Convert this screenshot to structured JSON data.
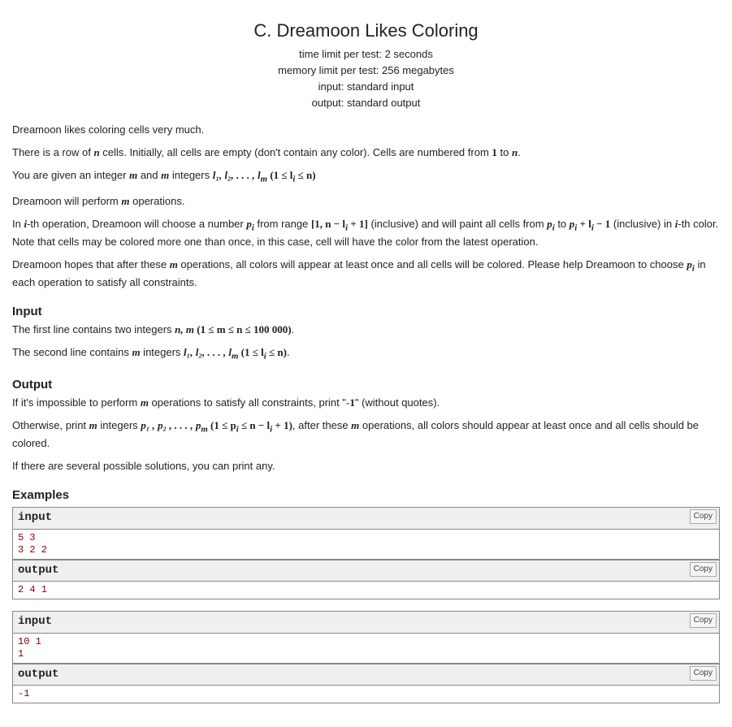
{
  "title": "C. Dreamoon Likes Coloring",
  "limits": {
    "time": "time limit per test: 2 seconds",
    "memory": "memory limit per test: 256 megabytes",
    "input": "input: standard input",
    "output": "output: standard output"
  },
  "statement": {
    "p1": "Dreamoon likes coloring cells very much.",
    "p2a": "There is a row of ",
    "p2b": " cells. Initially, all cells are empty (don't contain any color). Cells are numbered from ",
    "p2c": " to ",
    "p2d": ".",
    "p3a": "You are given an integer ",
    "p3b": " and ",
    "p3c": " integers ",
    "p4a": "Dreamoon will perform ",
    "p4b": " operations.",
    "p5a": "In ",
    "p5b": "-th operation, Dreamoon will choose a number ",
    "p5c": " from range ",
    "p5d": " (inclusive) and will paint all cells from ",
    "p5e": " to ",
    "p5f": " (inclusive) in ",
    "p5g": "-th color. Note that cells may be colored more one than once, in this case, cell will have the color from the latest operation.",
    "p6a": "Dreamoon hopes that after these ",
    "p6b": " operations, all colors will appear at least once and all cells will be colored. Please help Dreamoon to choose ",
    "p6c": " in each operation to satisfy all constraints."
  },
  "input_section": {
    "title": "Input",
    "p1a": "The first line contains two integers ",
    "p1b": ".",
    "p2a": "The second line contains ",
    "p2b": " integers ",
    "p2c": "."
  },
  "output_section": {
    "title": "Output",
    "p1a": "If it's impossible to perform ",
    "p1b": " operations to satisfy all constraints, print \"",
    "p1c": "\" (without quotes).",
    "p2a": "Otherwise, print ",
    "p2b": " integers ",
    "p2c": ", after these ",
    "p2d": " operations, all colors should appear at least once and all cells should be colored.",
    "p3": "If there are several possible solutions, you can print any."
  },
  "examples_title": "Examples",
  "labels": {
    "input": "input",
    "output": "output",
    "copy": "Copy"
  },
  "examples": [
    {
      "input": "5 3\n3 2 2",
      "output": "2 4 1"
    },
    {
      "input": "10 1\n1",
      "output": "-1"
    }
  ],
  "math": {
    "n": "n",
    "m": "m",
    "one": "1",
    "neg1": "-1",
    "i": "i",
    "pi": "p",
    "pi_sub": "i",
    "l_list": "l₁, l₂, . . . , l",
    "l_sub_m": "m",
    "l_constraint_open": " (1 ≤ l",
    "l_constraint_close": " ≤ n)",
    "nm": "n, m",
    "nm_constraint": " (1 ≤ m ≤ n ≤ 100 000)",
    "range": "[1, n − l",
    "range_close": " + 1]",
    "pili": "p",
    "plus_li": " + l",
    "minus1": " − 1",
    "p_list": "p₁ , p₂ , . . . , p",
    "p_constraint_open": " (1 ≤ p",
    "p_constraint_mid": " ≤ n − l",
    "p_constraint_close": " + 1)"
  }
}
